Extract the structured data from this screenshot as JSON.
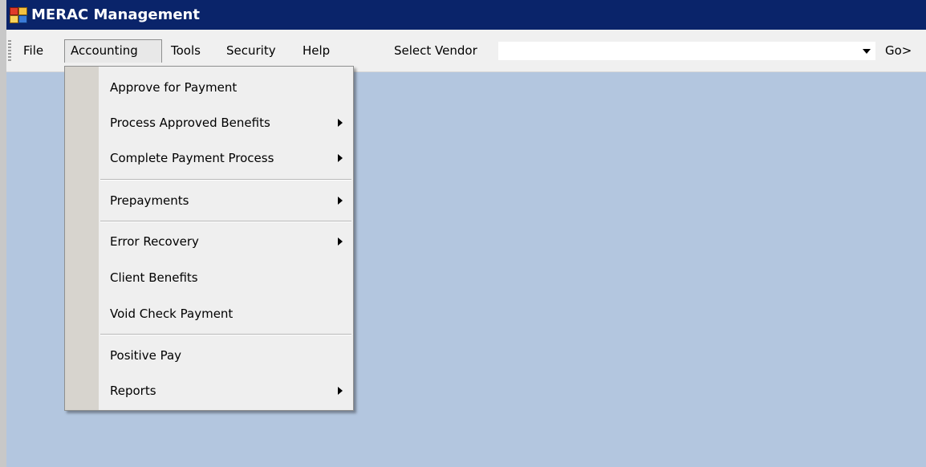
{
  "window": {
    "title": "MERAC Management"
  },
  "menubar": {
    "items": [
      {
        "label": "File"
      },
      {
        "label": "Accounting"
      },
      {
        "label": "Tools"
      },
      {
        "label": "Security"
      },
      {
        "label": "Help"
      }
    ],
    "open_menu": "Accounting"
  },
  "vendor": {
    "label": "Select Vendor",
    "value": "",
    "go_label": "Go>"
  },
  "accounting_menu": {
    "items": [
      {
        "label": "Approve for Payment",
        "has_submenu": false
      },
      {
        "label": "Process Approved Benefits",
        "has_submenu": true
      },
      {
        "label": "Complete Payment Process",
        "has_submenu": true
      },
      {
        "label": "Prepayments",
        "has_submenu": true
      },
      {
        "label": "Error Recovery",
        "has_submenu": true
      },
      {
        "label": "Client Benefits",
        "has_submenu": false
      },
      {
        "label": "Void Check Payment",
        "has_submenu": false
      },
      {
        "label": "Positive Pay",
        "has_submenu": false
      },
      {
        "label": "Reports",
        "has_submenu": true
      }
    ]
  },
  "colors": {
    "titlebar": "#0a246a",
    "workspace": "#b3c6df",
    "menubar": "#f0f0f0",
    "menu_gutter": "#d7d4ce"
  },
  "icons": {
    "app": "app-window-icon",
    "submenu": "chevron-right-icon",
    "combo": "dropdown-arrow-icon"
  }
}
